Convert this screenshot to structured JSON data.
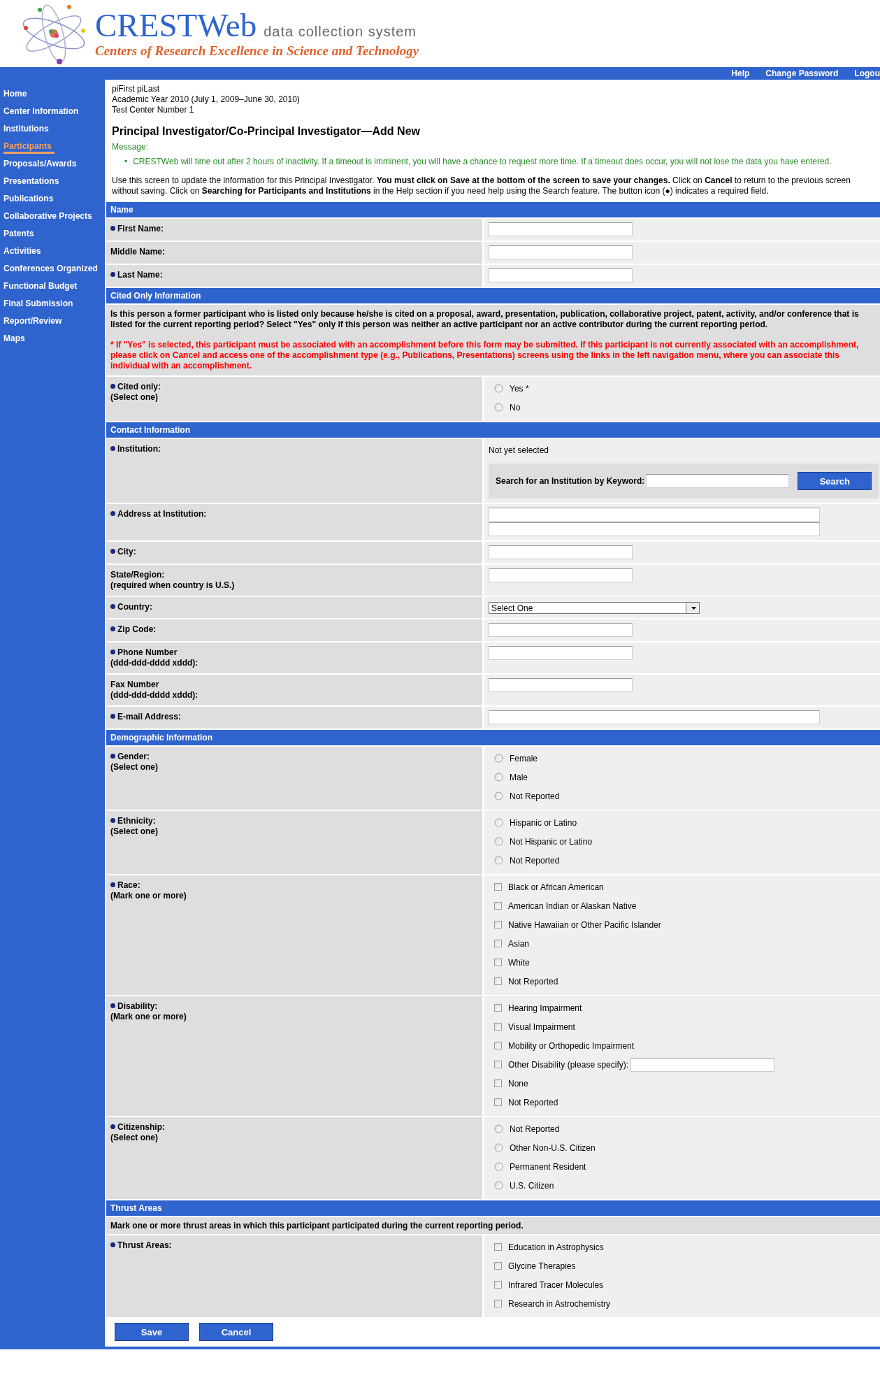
{
  "header": {
    "title": "CRESTWeb",
    "subtitle": "data collection system",
    "tagline": "Centers of Research Excellence in Science and Technology"
  },
  "top_links": [
    "Help",
    "Change Password",
    "Logou"
  ],
  "sidebar": [
    {
      "label": "Home",
      "selected": false
    },
    {
      "label": "Center Information",
      "selected": false
    },
    {
      "label": "Institutions",
      "selected": false
    },
    {
      "label": "Participants",
      "selected": true
    },
    {
      "label": "Proposals/Awards",
      "selected": false
    },
    {
      "label": "Presentations",
      "selected": false
    },
    {
      "label": "Publications",
      "selected": false
    },
    {
      "label": "Collaborative Projects",
      "selected": false
    },
    {
      "label": "Patents",
      "selected": false
    },
    {
      "label": "Activities",
      "selected": false
    },
    {
      "label": "Conferences Organized",
      "selected": false
    },
    {
      "label": "Functional Budget",
      "selected": false
    },
    {
      "label": "Final Submission",
      "selected": false
    },
    {
      "label": "Report/Review",
      "selected": false
    },
    {
      "label": "Maps",
      "selected": false
    }
  ],
  "context": [
    "piFirst piLast",
    "Academic Year 2010 (July 1, 2009–June 30, 2010)",
    "Test Center Number 1"
  ],
  "page_title": "Principal Investigator/Co-Principal Investigator—Add New",
  "message": {
    "label": "Message:",
    "marker": "•",
    "items": [
      "CRESTWeb will time out after 2 hours of inactivity. If a timeout is imminent, you will have a chance to request more time. If a timeout does occur, you will not lose the data you have entered."
    ]
  },
  "instructions": "Use this screen to update the information for this Principal Investigator. **You must click on Save at the bottom of the screen to save your changes.** Click on **Cancel** to return to the previous screen without saving. Click on **Searching for Participants and Institutions** in the Help section if you need help using the Search feature. The button icon (●) indicates a required field.",
  "sections": [
    {
      "title": "Name",
      "rows": [
        {
          "kind": "text",
          "label": "First Name:",
          "required": true
        },
        {
          "kind": "text",
          "label": "Middle Name:",
          "required": false
        },
        {
          "kind": "text",
          "label": "Last Name:",
          "required": true
        }
      ]
    },
    {
      "title": "Cited Only Information",
      "notes": [
        {
          "kind": "plain",
          "text": "Is this person a former participant who is listed only because he/she is cited on a proposal, award, presentation, publication, collaborative project, patent, activity, and/or conference that is listed for the current reporting period? Select \"Yes\" only if this person was neither an active participant nor an active contributor during the current reporting period."
        },
        {
          "kind": "warning",
          "text": "* If \"Yes\" is selected, this participant must be associated with an accomplishment before this form may be submitted. If this participant is not currently associated with an accomplishment, please click on Cancel and access one of the accomplishment type (e.g., Publications, Presentations) screens using the links in the left navigation menu, where you can associate this individual with an accomplishment."
        }
      ],
      "rows": [
        {
          "kind": "radio",
          "label": "Cited only:",
          "sublabel": "(Select one)",
          "required": true,
          "options": [
            {
              "label": "Yes *",
              "selected": false
            },
            {
              "label": "No",
              "selected": false
            }
          ]
        }
      ]
    },
    {
      "title": "Contact Information",
      "rows": [
        {
          "kind": "institution",
          "label": "Institution:",
          "required": true,
          "value": "Not yet selected",
          "search_label": "Search for an Institution by Keyword:",
          "button": "Search"
        },
        {
          "kind": "address",
          "label": "Address at Institution:",
          "required": true
        },
        {
          "kind": "text",
          "label": "City:",
          "required": true
        },
        {
          "kind": "text",
          "label": "State/Region:",
          "sublabel": "(required when country is U.S.)",
          "required": false
        },
        {
          "kind": "select",
          "label": "Country:",
          "required": true,
          "value": "Select One"
        },
        {
          "kind": "text",
          "label": "Zip Code:",
          "required": true
        },
        {
          "kind": "text",
          "label": "Phone Number",
          "sublabel": "(ddd-ddd-dddd xddd):",
          "required": true
        },
        {
          "kind": "text",
          "label": "Fax Number",
          "sublabel": "(ddd-ddd-dddd xddd):",
          "required": false
        },
        {
          "kind": "long_text",
          "label": "E-mail Address:",
          "required": true
        }
      ]
    },
    {
      "title": "Demographic Information",
      "rows": [
        {
          "kind": "radio",
          "label": "Gender:",
          "sublabel": "(Select one)",
          "required": true,
          "options": [
            {
              "label": "Female",
              "selected": false
            },
            {
              "label": "Male",
              "selected": false
            },
            {
              "label": "Not Reported",
              "selected": false
            }
          ]
        },
        {
          "kind": "radio",
          "label": "Ethnicity:",
          "sublabel": "(Select one)",
          "required": true,
          "options": [
            {
              "label": "Hispanic or Latino",
              "selected": false
            },
            {
              "label": "Not Hispanic or Latino",
              "selected": false
            },
            {
              "label": "Not Reported",
              "selected": false
            }
          ]
        },
        {
          "kind": "checkbox",
          "label": "Race:",
          "sublabel": "(Mark one or more)",
          "required": true,
          "options": [
            {
              "kind": "check",
              "label": "Black or African American",
              "checked": false
            },
            {
              "kind": "check",
              "label": "American Indian or Alaskan Native",
              "checked": false
            },
            {
              "kind": "check",
              "label": "Native Hawaiian or Other Pacific Islander",
              "checked": false
            },
            {
              "kind": "check",
              "label": "Asian",
              "checked": false
            },
            {
              "kind": "check",
              "label": "White",
              "checked": false
            },
            {
              "kind": "check",
              "label": "Not Reported",
              "checked": false
            }
          ]
        },
        {
          "kind": "checkbox",
          "label": "Disability:",
          "sublabel": "(Mark one or more)",
          "required": true,
          "options": [
            {
              "kind": "check",
              "label": "Hearing Impairment",
              "checked": false
            },
            {
              "kind": "check",
              "label": "Visual Impairment",
              "checked": false
            },
            {
              "kind": "check",
              "label": "Mobility or Orthopedic Impairment",
              "checked": false
            },
            {
              "kind": "check_field",
              "label": "Other Disability (please specify):",
              "checked": false
            },
            {
              "kind": "check",
              "label": "None",
              "checked": false
            },
            {
              "kind": "check",
              "label": "Not Reported",
              "checked": false
            }
          ]
        },
        {
          "kind": "radio",
          "label": "Citizenship:",
          "sublabel": "(Select one)",
          "required": true,
          "options": [
            {
              "label": "Not Reported",
              "selected": false
            },
            {
              "label": "Other Non-U.S. Citizen",
              "selected": false
            },
            {
              "label": "Permanent Resident",
              "selected": false
            },
            {
              "label": "U.S. Citizen",
              "selected": false
            }
          ]
        }
      ]
    },
    {
      "title": "Thrust Areas",
      "notes": [
        {
          "kind": "band",
          "text": "Mark one or more thrust areas in which this participant participated during the current reporting period."
        }
      ],
      "rows": [
        {
          "kind": "checkbox",
          "label": "Thrust Areas:",
          "required": true,
          "options": [
            {
              "kind": "check",
              "label": "Education in Astrophysics",
              "checked": false
            },
            {
              "kind": "check",
              "label": "Glycine Therapies",
              "checked": false
            },
            {
              "kind": "check",
              "label": "Infrared Tracer Molecules",
              "checked": false
            },
            {
              "kind": "check",
              "label": "Research in Astrochemistry",
              "checked": false
            }
          ]
        }
      ]
    }
  ],
  "buttons": [
    "Save",
    "Cancel"
  ]
}
